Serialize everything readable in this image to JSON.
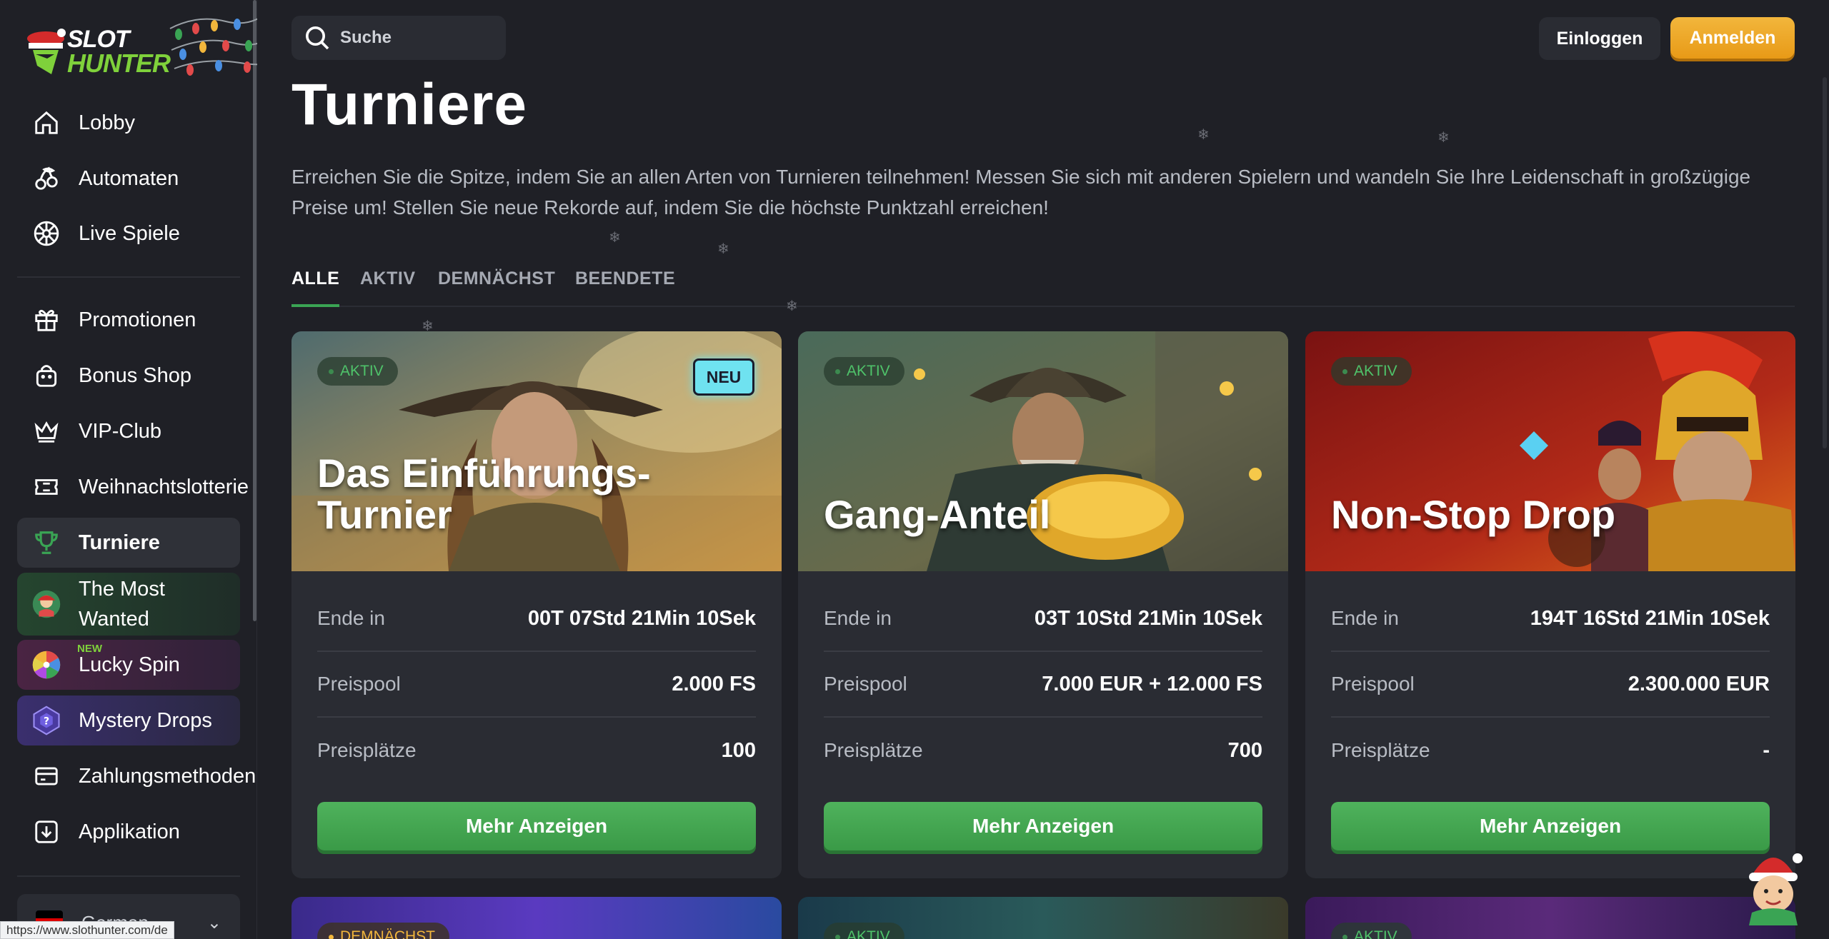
{
  "sidebar": {
    "logo": {
      "line1": "SLOT",
      "line2": "HUNTER"
    },
    "items": [
      {
        "label": "Lobby",
        "icon": "home-icon"
      },
      {
        "label": "Automaten",
        "icon": "cherries-icon"
      },
      {
        "label": "Live Spiele",
        "icon": "roulette-icon"
      },
      {
        "label": "Promotionen",
        "icon": "gift-icon"
      },
      {
        "label": "Bonus Shop",
        "icon": "shopping-bag-icon"
      },
      {
        "label": "VIP-Club",
        "icon": "crown-icon"
      },
      {
        "label": "Weihnachtslotterie",
        "icon": "ticket-icon"
      },
      {
        "label": "Turniere",
        "icon": "trophy-icon",
        "active": true
      },
      {
        "label": "The Most Wanted",
        "icon": "wanted-avatar-icon"
      },
      {
        "label": "Lucky Spin",
        "icon": "wheel-icon",
        "tag": "NEW"
      },
      {
        "label": "Mystery Drops",
        "icon": "mystery-drop-icon"
      },
      {
        "label": "Zahlungsmethoden",
        "icon": "card-icon"
      },
      {
        "label": "Applikation",
        "icon": "download-icon"
      }
    ],
    "language": "German"
  },
  "status_url": "https://www.slothunter.com/de",
  "topbar": {
    "search_placeholder": "Suche",
    "login_label": "Einloggen",
    "register_label": "Anmelden"
  },
  "main": {
    "title": "Turniere",
    "description": "Erreichen Sie die Spitze, indem Sie an allen Arten von Turnieren teilnehmen! Messen Sie sich mit anderen Spielern und wandeln Sie Ihre Leidenschaft in großzügige Preise um! Stellen Sie neue Rekorde auf, indem Sie die höchste Punktzahl erreichen!",
    "tabs": [
      {
        "label": "ALLE",
        "active": true
      },
      {
        "label": "AKTIV"
      },
      {
        "label": "DEMNÄCHST"
      },
      {
        "label": "BEENDETE"
      }
    ],
    "cards": [
      {
        "status": "AKTIV",
        "new_badge": "NEU",
        "title": "Das Einführungs-Turnier",
        "ends_label": "Ende in",
        "ends_value": "00T 07Std 21Min 10Sek",
        "pool_label": "Preispool",
        "pool_value": "2.000 FS",
        "places_label": "Preisplätze",
        "places_value": "100",
        "button": "Mehr Anzeigen"
      },
      {
        "status": "AKTIV",
        "title": "Gang-Anteil",
        "ends_label": "Ende in",
        "ends_value": "03T 10Std 21Min 10Sek",
        "pool_label": "Preispool",
        "pool_value": "7.000 EUR + 12.000 FS",
        "places_label": "Preisplätze",
        "places_value": "700",
        "button": "Mehr Anzeigen"
      },
      {
        "status": "AKTIV",
        "title": "Non-Stop Drop",
        "ends_label": "Ende in",
        "ends_value": "194T 16Std 21Min 10Sek",
        "pool_label": "Preispool",
        "pool_value": "2.300.000 EUR",
        "places_label": "Preisplätze",
        "places_value": "-",
        "button": "Mehr Anzeigen"
      }
    ],
    "next_row": [
      {
        "status": "DEMNÄCHST"
      },
      {
        "status": "AKTIV"
      },
      {
        "status": "AKTIV"
      }
    ]
  },
  "colors": {
    "background": "#1f2026",
    "card": "#2a2c33",
    "accent_green": "#3aa454",
    "accent_orange": "#f2b63c",
    "active_badge": "#4fc36a"
  }
}
